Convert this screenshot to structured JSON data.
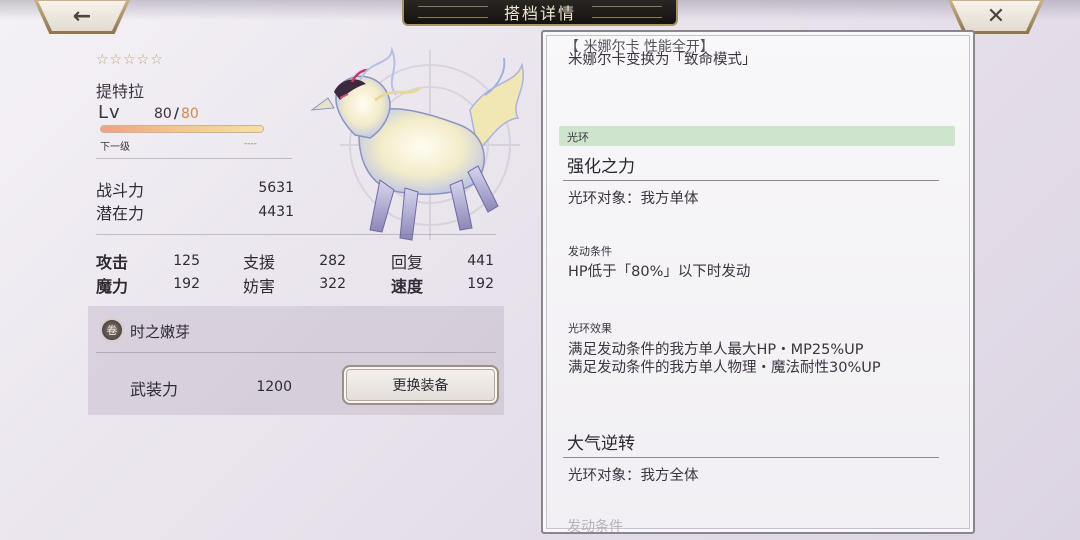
{
  "header": {
    "title": "搭档详情",
    "back_icon": "←",
    "close_icon": "✕"
  },
  "partner": {
    "stars": "☆☆☆☆☆",
    "name": "提特拉",
    "level_label": "Lv",
    "level_current": "80",
    "level_max": "80",
    "next_level_label": "下一级",
    "next_level_value": "----",
    "exp_fraction": 1.0,
    "combat_power_label": "战斗力",
    "combat_power": "5631",
    "potential_label": "潜在力",
    "potential": "4431"
  },
  "stats": [
    {
      "label": "攻击",
      "value": "125"
    },
    {
      "label": "支援",
      "value": "282"
    },
    {
      "label": "回复",
      "value": "441"
    },
    {
      "label": "魔力",
      "value": "192"
    },
    {
      "label": "妨害",
      "value": "322"
    },
    {
      "label": "速度",
      "value": "192"
    }
  ],
  "equipment": {
    "icon": "卷",
    "name": "时之嫩芽",
    "power_label": "武装力",
    "power": "1200",
    "change_button": "更换装备"
  },
  "detail": {
    "clipped_top": "【  米娜尔卡   性能全开】",
    "clipped_line": "米娜尔卡变换为「致命模式」",
    "category": "光环",
    "skills": [
      {
        "title": "强化之力",
        "target": "光环对象：我方单体",
        "condition_label": "发动条件",
        "condition": "HP低于「80%」以下时发动",
        "effect_label": "光环效果",
        "effect_line1": "满足发动条件的我方单人最大HP・MP25%UP",
        "effect_line2": "满足发动条件的我方单人物理・魔法耐性30%UP"
      },
      {
        "title": "大气逆转",
        "target": "光环对象：我方全体"
      }
    ],
    "clipped_bottom": "发动条件"
  },
  "colors": {
    "accent_gold": "#b9a77a",
    "level_max": "#d38a45",
    "category_band": "#cfe4cc"
  }
}
